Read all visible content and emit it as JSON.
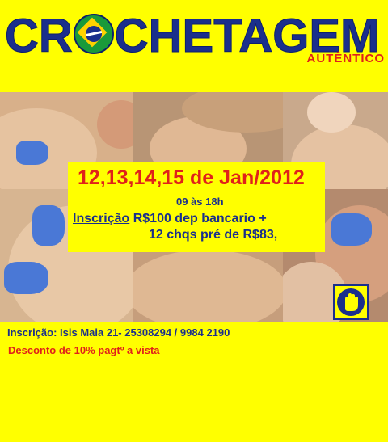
{
  "header": {
    "title_part1": "CR",
    "title_part2": "CHETAGEM",
    "subtitle": "AUTÊNTICO"
  },
  "event": {
    "dates": "12,13,14,15 de Jan/2012",
    "hours": "09 às 18h",
    "registration_label": "Inscrição",
    "registration_price": " R$100 dep bancario +",
    "installments": "12 chqs pré de R$83,"
  },
  "footer": {
    "contact": "Inscrição: Isis Maia 21- 25308294 / 9984 2190",
    "discount": "Desconto de 10% pagtº a vista"
  },
  "colors": {
    "background": "#ffff00",
    "brand_blue": "#1a2f8c",
    "accent_red": "#e0211a",
    "glove_blue": "#4a78d6"
  },
  "icons": [
    "brazil-flag-icon",
    "hand-logo-icon"
  ]
}
